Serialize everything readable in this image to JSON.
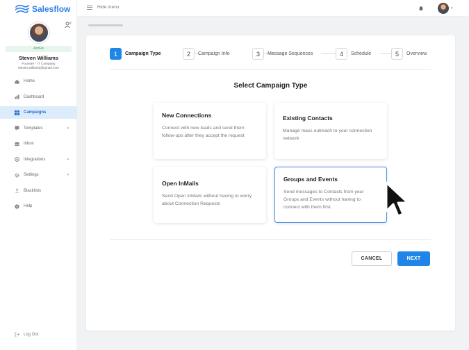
{
  "brand": {
    "name": "Salesflow",
    "color": "#2e7de9"
  },
  "profile": {
    "status": "Active",
    "name": "Steven Williams",
    "role": "Founder - IT Company",
    "email": "steven.williams@gmail.com"
  },
  "sidebar": {
    "items": [
      {
        "label": "Home",
        "icon": "home-icon",
        "active": false
      },
      {
        "label": "Dashboard",
        "icon": "dashboard-icon",
        "active": false
      },
      {
        "label": "Campaigns",
        "icon": "grid-icon",
        "active": true
      },
      {
        "label": "Templates",
        "icon": "template-icon",
        "active": false,
        "expandable": true
      },
      {
        "label": "Inbox",
        "icon": "inbox-icon",
        "active": false
      },
      {
        "label": "Integrations",
        "icon": "integrations-icon",
        "active": false,
        "expandable": true
      },
      {
        "label": "Settings",
        "icon": "gear-icon",
        "active": false,
        "expandable": true
      },
      {
        "label": "Blacklists",
        "icon": "block-icon",
        "active": false
      },
      {
        "label": "Help",
        "icon": "help-icon",
        "active": false
      }
    ],
    "logout": "Log Out"
  },
  "topbar": {
    "hide_menu": "Hide menu"
  },
  "steps": [
    {
      "num": "1",
      "label": "Campaign Type",
      "active": true
    },
    {
      "num": "2",
      "label": "Campaign Info",
      "active": false
    },
    {
      "num": "3",
      "label": "Message Sequences",
      "active": false
    },
    {
      "num": "4",
      "label": "Schedule",
      "active": false
    },
    {
      "num": "5",
      "label": "Overview",
      "active": false
    }
  ],
  "main": {
    "title": "Select Campaign Type",
    "types": [
      {
        "title": "New Connections",
        "desc": "Connect with new leads and send them follow-ups after they accept the request",
        "selected": false
      },
      {
        "title": "Existing Contacts",
        "desc": "Manage mass outreach to your connection network",
        "selected": false
      },
      {
        "title": "Open InMails",
        "desc": "Send Open InMails without having to worry about Connection Requests",
        "selected": false
      },
      {
        "title": "Groups and Events",
        "desc": "Send messages to Contacts from your Groups and Events without having to connect with them first.",
        "selected": true
      }
    ],
    "cancel": "CANCEL",
    "next": "NEXT"
  },
  "colors": {
    "accent": "#1f86e8",
    "active_nav_bg": "#dcecfb",
    "status_green": "#3aa86b"
  }
}
